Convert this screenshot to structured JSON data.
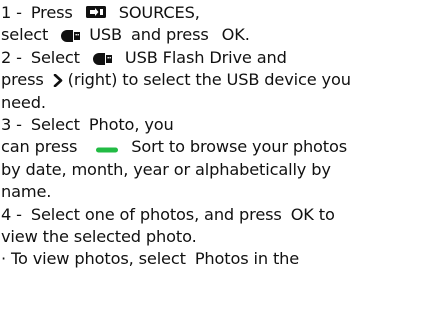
{
  "steps": {
    "s1": {
      "num": "1 -",
      "press": "Press",
      "sources": "SOURCES,",
      "select": "select",
      "usb": "USB",
      "and_press": "and press",
      "ok": "OK."
    },
    "s2": {
      "num": "2 -",
      "select": "Select",
      "flash": "USB Flash Drive",
      "and": "and",
      "press": "press",
      "right_text": "(right) to select the USB device you",
      "need": "need."
    },
    "s3": {
      "num": "3 -",
      "select": "Select",
      "photo": "Photo",
      "you": ", you",
      "can_press": "can press",
      "sort": "Sort",
      "browse": "to browse your photos",
      "line3": "by date, month, year or alphabetically by",
      "line4": "name."
    },
    "s4": {
      "num": "4 -",
      "text1": "Select one of photos, and press",
      "ok": "OK",
      "to": "to",
      "line2": "view the selected photo."
    },
    "bullet": {
      "text": "· To view photos, select",
      "photos": "Photos",
      "in_the": "in the"
    }
  },
  "icons": {
    "sources": "sources-input-icon",
    "usb": "usb-drive-icon",
    "right": "chevron-right-icon",
    "green": "green-color-key-icon"
  },
  "colors": {
    "text": "#111111",
    "green_key": "#22bb44"
  }
}
